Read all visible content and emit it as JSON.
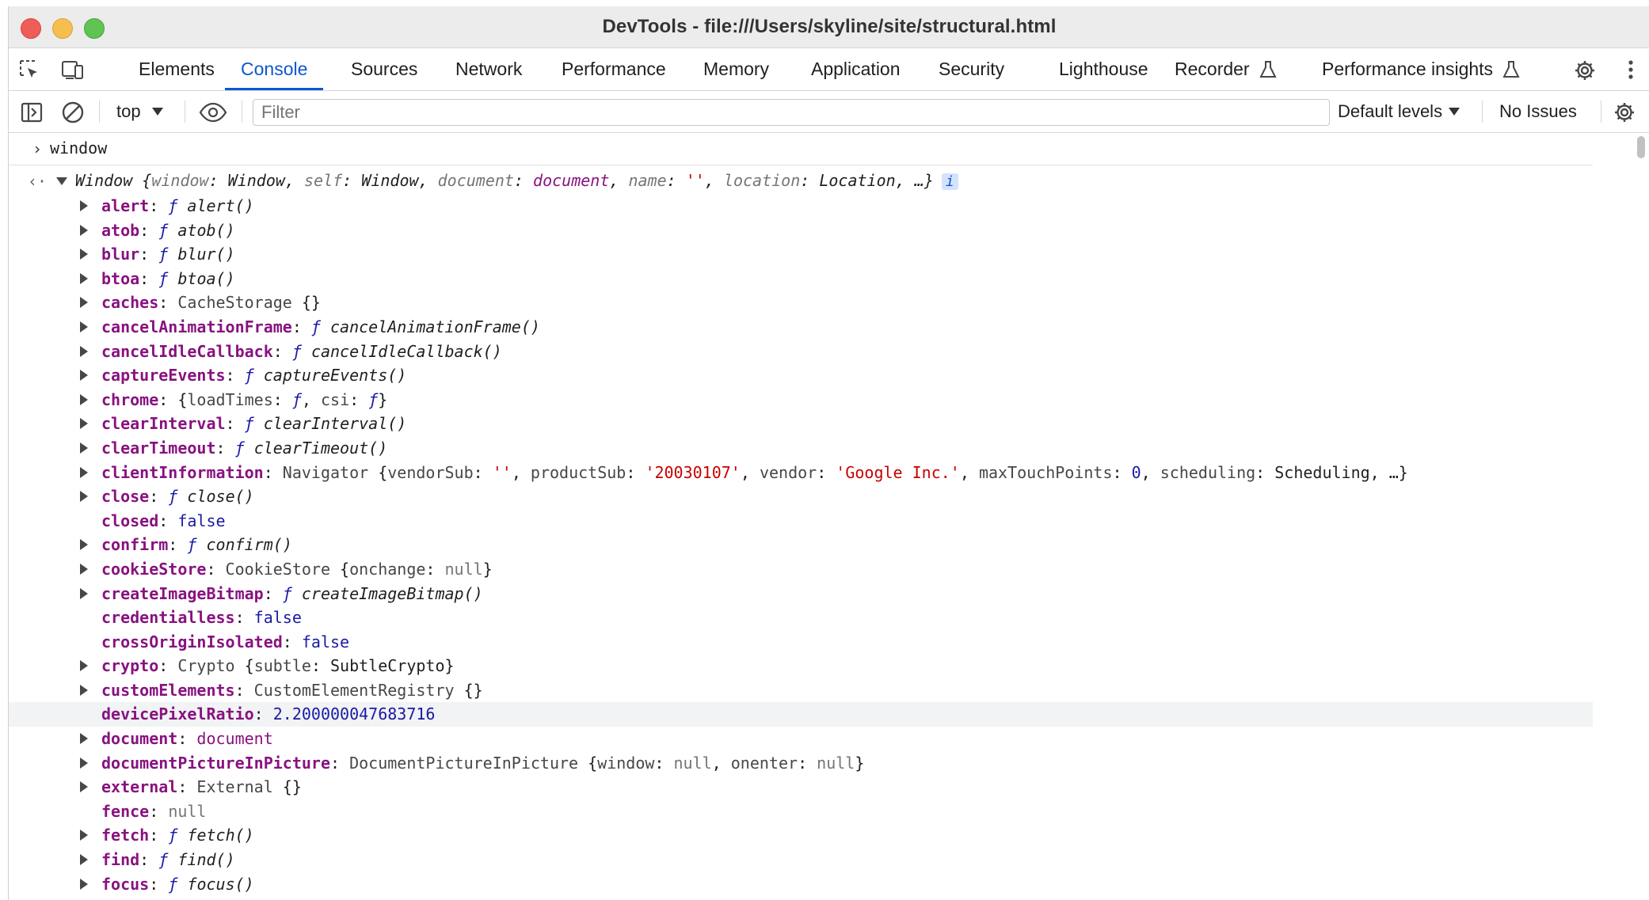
{
  "window": {
    "title": "DevTools - file:///Users/skyline/site/structural.html"
  },
  "tabs": [
    {
      "label": "Elements",
      "active": false
    },
    {
      "label": "Console",
      "active": true
    },
    {
      "label": "Sources",
      "active": false
    },
    {
      "label": "Network",
      "active": false
    },
    {
      "label": "Performance",
      "active": false
    },
    {
      "label": "Memory",
      "active": false
    },
    {
      "label": "Application",
      "active": false
    },
    {
      "label": "Security",
      "active": false
    },
    {
      "label": "Lighthouse",
      "active": false
    },
    {
      "label": "Recorder",
      "active": false,
      "icon": "flask-icon"
    },
    {
      "label": "Performance insights",
      "active": false,
      "icon": "flask-icon"
    }
  ],
  "toolbar": {
    "context": "top",
    "filter_placeholder": "Filter",
    "filter_value": "",
    "levels": "Default levels",
    "issues": "No Issues"
  },
  "console": {
    "input": "window",
    "result_header": {
      "name": "Window",
      "preview": [
        {
          "k": "window",
          "v": "Window",
          "t": "plain"
        },
        {
          "k": "self",
          "v": "Window",
          "t": "plain"
        },
        {
          "k": "document",
          "v": "document",
          "t": "doc"
        },
        {
          "k": "name",
          "v": "''",
          "t": "str"
        },
        {
          "k": "location",
          "v": "Location",
          "t": "plain"
        }
      ],
      "ellipsis": "…}",
      "info_badge": "i"
    },
    "properties": [
      {
        "key": "alert",
        "expandable": true,
        "segs": [
          [
            "fnf",
            "ƒ"
          ],
          [
            "sp",
            " "
          ],
          [
            "fn",
            "alert()"
          ]
        ]
      },
      {
        "key": "atob",
        "expandable": true,
        "segs": [
          [
            "fnf",
            "ƒ"
          ],
          [
            "sp",
            " "
          ],
          [
            "fn",
            "atob()"
          ]
        ]
      },
      {
        "key": "blur",
        "expandable": true,
        "segs": [
          [
            "fnf",
            "ƒ"
          ],
          [
            "sp",
            " "
          ],
          [
            "fn",
            "blur()"
          ]
        ]
      },
      {
        "key": "btoa",
        "expandable": true,
        "segs": [
          [
            "fnf",
            "ƒ"
          ],
          [
            "sp",
            " "
          ],
          [
            "fn",
            "btoa()"
          ]
        ]
      },
      {
        "key": "caches",
        "expandable": true,
        "segs": [
          [
            "cls",
            "CacheStorage"
          ],
          [
            "plain",
            " {}"
          ]
        ]
      },
      {
        "key": "cancelAnimationFrame",
        "expandable": true,
        "segs": [
          [
            "fnf",
            "ƒ"
          ],
          [
            "sp",
            " "
          ],
          [
            "fn",
            "cancelAnimationFrame()"
          ]
        ]
      },
      {
        "key": "cancelIdleCallback",
        "expandable": true,
        "segs": [
          [
            "fnf",
            "ƒ"
          ],
          [
            "sp",
            " "
          ],
          [
            "fn",
            "cancelIdleCallback()"
          ]
        ]
      },
      {
        "key": "captureEvents",
        "expandable": true,
        "segs": [
          [
            "fnf",
            "ƒ"
          ],
          [
            "sp",
            " "
          ],
          [
            "fn",
            "captureEvents()"
          ]
        ]
      },
      {
        "key": "chrome",
        "expandable": true,
        "segs": [
          [
            "plain",
            "{"
          ],
          [
            "cls",
            "loadTimes"
          ],
          [
            "plain",
            ": "
          ],
          [
            "fnf",
            "ƒ"
          ],
          [
            "plain",
            ", "
          ],
          [
            "cls",
            "csi"
          ],
          [
            "plain",
            ": "
          ],
          [
            "fnf",
            "ƒ"
          ],
          [
            "plain",
            "}"
          ]
        ]
      },
      {
        "key": "clearInterval",
        "expandable": true,
        "segs": [
          [
            "fnf",
            "ƒ"
          ],
          [
            "sp",
            " "
          ],
          [
            "fn",
            "clearInterval()"
          ]
        ]
      },
      {
        "key": "clearTimeout",
        "expandable": true,
        "segs": [
          [
            "fnf",
            "ƒ"
          ],
          [
            "sp",
            " "
          ],
          [
            "fn",
            "clearTimeout()"
          ]
        ]
      },
      {
        "key": "clientInformation",
        "expandable": true,
        "segs": [
          [
            "cls",
            "Navigator"
          ],
          [
            "plain",
            " {"
          ],
          [
            "cls",
            "vendorSub"
          ],
          [
            "plain",
            ": "
          ],
          [
            "str",
            "''"
          ],
          [
            "plain",
            ", "
          ],
          [
            "cls",
            "productSub"
          ],
          [
            "plain",
            ": "
          ],
          [
            "str",
            "'20030107'"
          ],
          [
            "plain",
            ", "
          ],
          [
            "cls",
            "vendor"
          ],
          [
            "plain",
            ": "
          ],
          [
            "str",
            "'Google Inc.'"
          ],
          [
            "plain",
            ", "
          ],
          [
            "cls",
            "maxTouchPoints"
          ],
          [
            "plain",
            ": "
          ],
          [
            "num",
            "0"
          ],
          [
            "plain",
            ", "
          ],
          [
            "cls",
            "scheduling"
          ],
          [
            "plain",
            ": Scheduling, …}"
          ]
        ]
      },
      {
        "key": "close",
        "expandable": true,
        "segs": [
          [
            "fnf",
            "ƒ"
          ],
          [
            "sp",
            " "
          ],
          [
            "fn",
            "close()"
          ]
        ]
      },
      {
        "key": "closed",
        "expandable": false,
        "segs": [
          [
            "bool",
            "false"
          ]
        ]
      },
      {
        "key": "confirm",
        "expandable": true,
        "segs": [
          [
            "fnf",
            "ƒ"
          ],
          [
            "sp",
            " "
          ],
          [
            "fn",
            "confirm()"
          ]
        ]
      },
      {
        "key": "cookieStore",
        "expandable": true,
        "segs": [
          [
            "cls",
            "CookieStore"
          ],
          [
            "plain",
            " {"
          ],
          [
            "cls",
            "onchange"
          ],
          [
            "plain",
            ": "
          ],
          [
            "nul",
            "null"
          ],
          [
            "plain",
            "}"
          ]
        ]
      },
      {
        "key": "createImageBitmap",
        "expandable": true,
        "segs": [
          [
            "fnf",
            "ƒ"
          ],
          [
            "sp",
            " "
          ],
          [
            "fn",
            "createImageBitmap()"
          ]
        ]
      },
      {
        "key": "credentialless",
        "expandable": false,
        "segs": [
          [
            "bool",
            "false"
          ]
        ]
      },
      {
        "key": "crossOriginIsolated",
        "expandable": false,
        "segs": [
          [
            "bool",
            "false"
          ]
        ]
      },
      {
        "key": "crypto",
        "expandable": true,
        "segs": [
          [
            "cls",
            "Crypto"
          ],
          [
            "plain",
            " {"
          ],
          [
            "cls",
            "subtle"
          ],
          [
            "plain",
            ": SubtleCrypto}"
          ]
        ]
      },
      {
        "key": "customElements",
        "expandable": true,
        "segs": [
          [
            "cls",
            "CustomElementRegistry"
          ],
          [
            "plain",
            " {}"
          ]
        ]
      },
      {
        "key": "devicePixelRatio",
        "expandable": false,
        "highlight": true,
        "segs": [
          [
            "num",
            "2.200000047683716"
          ]
        ]
      },
      {
        "key": "document",
        "expandable": true,
        "segs": [
          [
            "doc",
            "document"
          ]
        ]
      },
      {
        "key": "documentPictureInPicture",
        "expandable": true,
        "segs": [
          [
            "cls",
            "DocumentPictureInPicture"
          ],
          [
            "plain",
            " {"
          ],
          [
            "cls",
            "window"
          ],
          [
            "plain",
            ": "
          ],
          [
            "nul",
            "null"
          ],
          [
            "plain",
            ", "
          ],
          [
            "cls",
            "onenter"
          ],
          [
            "plain",
            ": "
          ],
          [
            "nul",
            "null"
          ],
          [
            "plain",
            "}"
          ]
        ]
      },
      {
        "key": "external",
        "expandable": true,
        "segs": [
          [
            "cls",
            "External"
          ],
          [
            "plain",
            " {}"
          ]
        ]
      },
      {
        "key": "fence",
        "expandable": false,
        "segs": [
          [
            "nul",
            "null"
          ]
        ]
      },
      {
        "key": "fetch",
        "expandable": true,
        "segs": [
          [
            "fnf",
            "ƒ"
          ],
          [
            "sp",
            " "
          ],
          [
            "fn",
            "fetch()"
          ]
        ]
      },
      {
        "key": "find",
        "expandable": true,
        "segs": [
          [
            "fnf",
            "ƒ"
          ],
          [
            "sp",
            " "
          ],
          [
            "fn",
            "find()"
          ]
        ]
      },
      {
        "key": "focus",
        "expandable": true,
        "segs": [
          [
            "fnf",
            "ƒ"
          ],
          [
            "sp",
            " "
          ],
          [
            "fn",
            "focus()"
          ]
        ]
      }
    ]
  }
}
